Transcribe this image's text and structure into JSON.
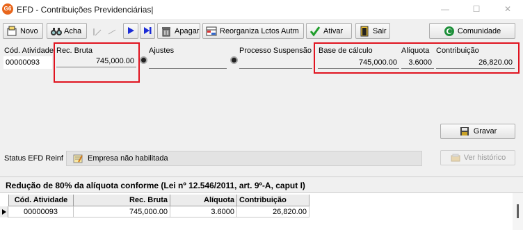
{
  "window": {
    "logo": "G6",
    "title": "EFD - Contribuições Previdenciárias|"
  },
  "toolbar": {
    "novo": "Novo",
    "acha": "Acha",
    "apagar": "Apagar",
    "reorganiza": "Reorganiza Lctos Autm",
    "ativar": "Ativar",
    "sair": "Sair",
    "comunidade": "Comunidade"
  },
  "form": {
    "cod_atividade_label": "Cód. Atividade",
    "cod_atividade_value": "00000093",
    "rec_bruta_label": "Rec. Bruta",
    "rec_bruta_value": "745,000.00",
    "ajustes_label": "Ajustes",
    "ajustes_value": "",
    "processo_label": "Processo Suspensão",
    "processo_value": "",
    "base_calculo_label": "Base de cálculo",
    "base_calculo_value": "745,000.00",
    "aliquota_label": "Alíquota",
    "aliquota_value": "3.6000",
    "contribuicao_label": "Contribuição",
    "contribuicao_value": "26,820.00"
  },
  "actions": {
    "gravar": "Gravar",
    "ver_historico": "Ver histórico"
  },
  "status": {
    "label": "Status EFD Reinf",
    "value": "Empresa não habilitada"
  },
  "banner": {
    "text": "Redução de 80% da alíquota conforme (Lei nº 12.546/2011, art. 9º-A, caput I)"
  },
  "grid": {
    "columns": [
      "Cód. Atividade",
      "Rec. Bruta",
      "Alíquota",
      "Contribuição"
    ],
    "rows": [
      [
        "00000093",
        "745,000.00",
        "3.6000",
        "26,820.00"
      ]
    ]
  },
  "colors": {
    "highlight_border": "#e0131f",
    "logo_orange": "#e8661c",
    "ativar_check": "#1f9d2b",
    "nav_blue": "#1a2bd6"
  }
}
